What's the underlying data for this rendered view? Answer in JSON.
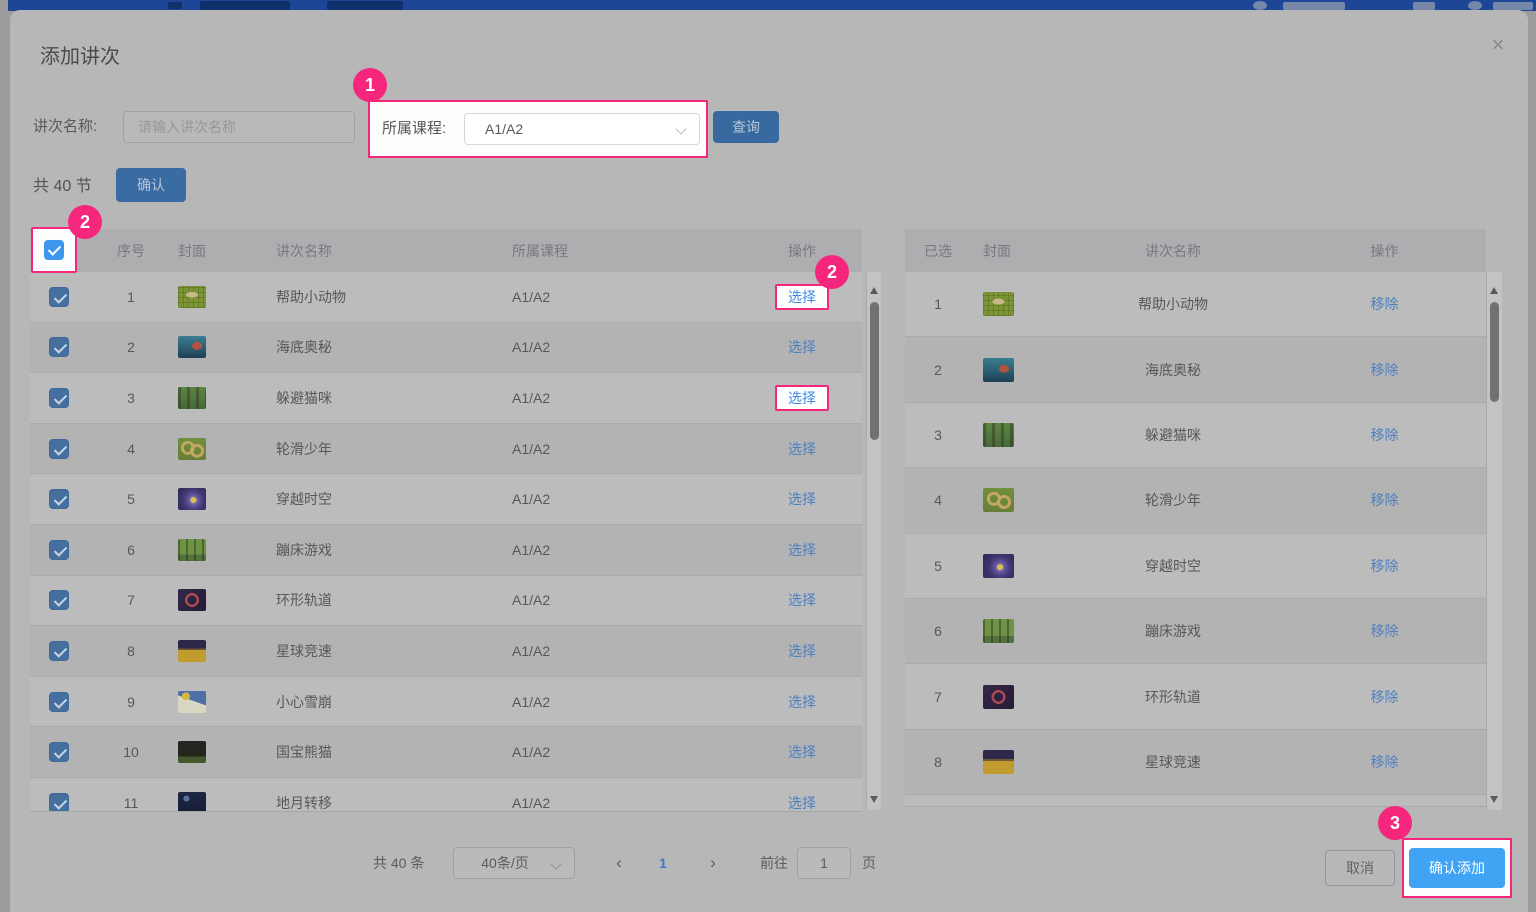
{
  "colors": {
    "accent_pink": "#f5267c",
    "primary_blue_dim": "#3a6ca4",
    "highlight_blue": "#41a3f3",
    "link_blue_dim": "#4c80c2",
    "link_blue_bright": "#3f8ce6"
  },
  "modal": {
    "title": "添加讲次",
    "close_icon": "×",
    "form": {
      "name_label": "讲次名称:",
      "name_placeholder": "请输入讲次名称",
      "course_label": "所属课程:",
      "course_value": "A1/A2",
      "search_button": "查询"
    },
    "summary": {
      "total_text": "共 40 节",
      "confirm_button": "确认"
    },
    "left_table": {
      "headers": [
        "序号",
        "封面",
        "讲次名称",
        "所属课程",
        "操作"
      ],
      "action_label": "选择",
      "rows": [
        {
          "num": "1",
          "name": "帮助小动物",
          "course": "A1/A2",
          "cover": "cover-grid-map",
          "hl": "hl"
        },
        {
          "num": "2",
          "name": "海底奥秘",
          "course": "A1/A2",
          "cover": "cover-undersea",
          "hl": ""
        },
        {
          "num": "3",
          "name": "躲避猫咪",
          "course": "A1/A2",
          "cover": "cover-forest-cat",
          "hl": "hl"
        },
        {
          "num": "4",
          "name": "轮滑少年",
          "course": "A1/A2",
          "cover": "cover-skate-path",
          "hl": ""
        },
        {
          "num": "5",
          "name": "穿越时空",
          "course": "A1/A2",
          "cover": "cover-time-spiral",
          "hl": ""
        },
        {
          "num": "6",
          "name": "蹦床游戏",
          "course": "A1/A2",
          "cover": "cover-trampoline-forest",
          "hl": ""
        },
        {
          "num": "7",
          "name": "环形轨道",
          "course": "A1/A2",
          "cover": "cover-ring-track",
          "hl": ""
        },
        {
          "num": "8",
          "name": "星球竞速",
          "course": "A1/A2",
          "cover": "cover-planet-race",
          "hl": ""
        },
        {
          "num": "9",
          "name": "小心雪崩",
          "course": "A1/A2",
          "cover": "cover-avalanche",
          "hl": ""
        },
        {
          "num": "10",
          "name": "国宝熊猫",
          "course": "A1/A2",
          "cover": "cover-panda-night",
          "hl": ""
        },
        {
          "num": "11",
          "name": "地月转移",
          "course": "A1/A2",
          "cover": "cover-earth-moon",
          "hl": ""
        }
      ]
    },
    "right_table": {
      "headers": [
        "已选",
        "封面",
        "讲次名称",
        "操作"
      ],
      "action_label": "移除",
      "rows": [
        {
          "num": "1",
          "name": "帮助小动物",
          "cover": "cover-grid-map"
        },
        {
          "num": "2",
          "name": "海底奥秘",
          "cover": "cover-undersea"
        },
        {
          "num": "3",
          "name": "躲避猫咪",
          "cover": "cover-forest-cat"
        },
        {
          "num": "4",
          "name": "轮滑少年",
          "cover": "cover-skate-path"
        },
        {
          "num": "5",
          "name": "穿越时空",
          "cover": "cover-time-spiral"
        },
        {
          "num": "6",
          "name": "蹦床游戏",
          "cover": "cover-trampoline-forest"
        },
        {
          "num": "7",
          "name": "环形轨道",
          "cover": "cover-ring-track"
        },
        {
          "num": "8",
          "name": "星球竞速",
          "cover": "cover-planet-race"
        }
      ]
    },
    "pagination": {
      "total_text": "共 40 条",
      "page_size": "40条/页",
      "prev": "‹",
      "current_page": "1",
      "next": "›",
      "goto_label": "前往",
      "goto_value": "1",
      "page_unit": "页"
    },
    "footer": {
      "cancel_button": "取消",
      "confirm_add_button": "确认添加"
    }
  },
  "annotations": {
    "badge1": "1",
    "badge2a": "2",
    "badge2b": "2",
    "badge3": "3"
  }
}
